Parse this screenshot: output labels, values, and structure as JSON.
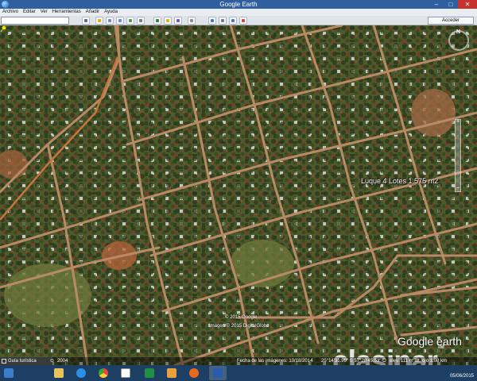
{
  "window": {
    "title": "Google Earth"
  },
  "menu": [
    "Archivo",
    "Editar",
    "Ver",
    "Herramientas",
    "Añadir",
    "Ayuda"
  ],
  "toolbar": {
    "signin_label": "Acceder"
  },
  "map": {
    "compass_letter": "N",
    "zoom_plus": "+",
    "zoom_minus": "−",
    "placemark_label": "Luque 4 Lotes 1.575 m2",
    "copyright_line1": "© 2015 Google",
    "copyright_line2": "Imagen © 2015 DigitalGlobe",
    "logo_text": "Google earth",
    "watermark_text": "clasipar",
    "watermark_tm": "TM"
  },
  "statusbar": {
    "sidebar_label": "Guía turística",
    "year": "2004",
    "imagery_date": "Fecha de las imágenes: 10/18/2014",
    "coords": "25°14'31.99\" S  57°28'45.53\" O",
    "elev_eye": "elev. 111 m  alt. ojo 1.08 km"
  },
  "taskbar": {
    "icons": [
      "start-button",
      "file-explorer-icon",
      "ie-icon",
      "chrome-icon",
      "spreadsheet-icon",
      "outlook-icon",
      "firefox-icon",
      "word-icon"
    ],
    "date": "05/06/2015"
  }
}
